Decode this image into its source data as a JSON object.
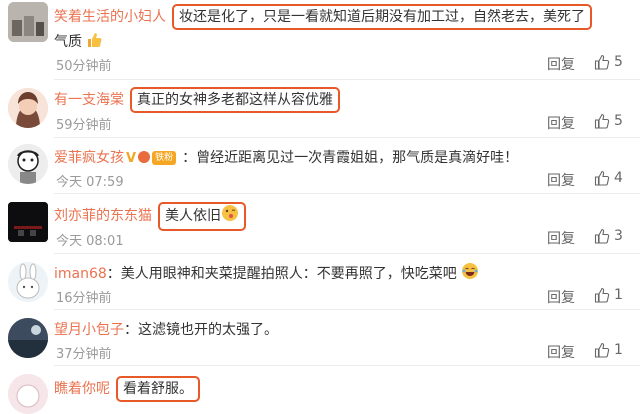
{
  "ui": {
    "reply_label": "回复",
    "like_icon": "thumbs-up-icon"
  },
  "comments": [
    {
      "user": "笑着生活的小妇人",
      "text": "妆还是化了，只是一看就知道后期没有加工过，自然老去，美死了",
      "text2": "气质",
      "time": "50分钟前",
      "likes": "5"
    },
    {
      "user": "有一支海棠",
      "text": "真正的女神多老都这样从容优雅",
      "time": "59分钟前",
      "likes": "5"
    },
    {
      "user": "爱菲疯女孩",
      "badge_fan": "铁粉",
      "text": "曾经近距离见过一次青霞姐姐，那气质是真滴好哇！",
      "time": "今天 07:59",
      "likes": "4"
    },
    {
      "user": "刘亦菲的东东猫",
      "text": "美人依旧",
      "time": "今天 08:01",
      "likes": "3"
    },
    {
      "user": "iman68",
      "text": "美人用眼神和夹菜提醒拍照人：不要再照了，快吃菜吧",
      "time": "16分钟前",
      "likes": "1"
    },
    {
      "user": "望月小包子",
      "text": "这滤镜也开的太强了。",
      "time": "37分钟前",
      "likes": "1"
    },
    {
      "user": "瞧着你呢",
      "text": "看着舒服。",
      "time": "",
      "likes": ""
    }
  ]
}
